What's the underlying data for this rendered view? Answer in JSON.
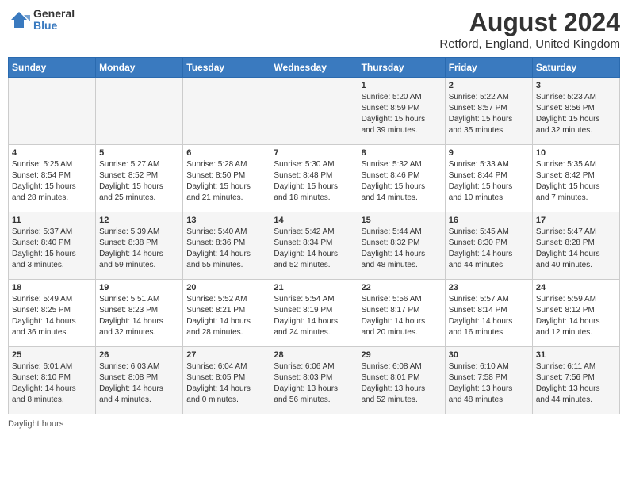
{
  "header": {
    "logo": {
      "general": "General",
      "blue": "Blue"
    },
    "title": "August 2024",
    "location": "Retford, England, United Kingdom"
  },
  "days_of_week": [
    "Sunday",
    "Monday",
    "Tuesday",
    "Wednesday",
    "Thursday",
    "Friday",
    "Saturday"
  ],
  "weeks": [
    [
      {
        "day": "",
        "info": ""
      },
      {
        "day": "",
        "info": ""
      },
      {
        "day": "",
        "info": ""
      },
      {
        "day": "",
        "info": ""
      },
      {
        "day": "1",
        "info": "Sunrise: 5:20 AM\nSunset: 8:59 PM\nDaylight: 15 hours\nand 39 minutes."
      },
      {
        "day": "2",
        "info": "Sunrise: 5:22 AM\nSunset: 8:57 PM\nDaylight: 15 hours\nand 35 minutes."
      },
      {
        "day": "3",
        "info": "Sunrise: 5:23 AM\nSunset: 8:56 PM\nDaylight: 15 hours\nand 32 minutes."
      }
    ],
    [
      {
        "day": "4",
        "info": "Sunrise: 5:25 AM\nSunset: 8:54 PM\nDaylight: 15 hours\nand 28 minutes."
      },
      {
        "day": "5",
        "info": "Sunrise: 5:27 AM\nSunset: 8:52 PM\nDaylight: 15 hours\nand 25 minutes."
      },
      {
        "day": "6",
        "info": "Sunrise: 5:28 AM\nSunset: 8:50 PM\nDaylight: 15 hours\nand 21 minutes."
      },
      {
        "day": "7",
        "info": "Sunrise: 5:30 AM\nSunset: 8:48 PM\nDaylight: 15 hours\nand 18 minutes."
      },
      {
        "day": "8",
        "info": "Sunrise: 5:32 AM\nSunset: 8:46 PM\nDaylight: 15 hours\nand 14 minutes."
      },
      {
        "day": "9",
        "info": "Sunrise: 5:33 AM\nSunset: 8:44 PM\nDaylight: 15 hours\nand 10 minutes."
      },
      {
        "day": "10",
        "info": "Sunrise: 5:35 AM\nSunset: 8:42 PM\nDaylight: 15 hours\nand 7 minutes."
      }
    ],
    [
      {
        "day": "11",
        "info": "Sunrise: 5:37 AM\nSunset: 8:40 PM\nDaylight: 15 hours\nand 3 minutes."
      },
      {
        "day": "12",
        "info": "Sunrise: 5:39 AM\nSunset: 8:38 PM\nDaylight: 14 hours\nand 59 minutes."
      },
      {
        "day": "13",
        "info": "Sunrise: 5:40 AM\nSunset: 8:36 PM\nDaylight: 14 hours\nand 55 minutes."
      },
      {
        "day": "14",
        "info": "Sunrise: 5:42 AM\nSunset: 8:34 PM\nDaylight: 14 hours\nand 52 minutes."
      },
      {
        "day": "15",
        "info": "Sunrise: 5:44 AM\nSunset: 8:32 PM\nDaylight: 14 hours\nand 48 minutes."
      },
      {
        "day": "16",
        "info": "Sunrise: 5:45 AM\nSunset: 8:30 PM\nDaylight: 14 hours\nand 44 minutes."
      },
      {
        "day": "17",
        "info": "Sunrise: 5:47 AM\nSunset: 8:28 PM\nDaylight: 14 hours\nand 40 minutes."
      }
    ],
    [
      {
        "day": "18",
        "info": "Sunrise: 5:49 AM\nSunset: 8:25 PM\nDaylight: 14 hours\nand 36 minutes."
      },
      {
        "day": "19",
        "info": "Sunrise: 5:51 AM\nSunset: 8:23 PM\nDaylight: 14 hours\nand 32 minutes."
      },
      {
        "day": "20",
        "info": "Sunrise: 5:52 AM\nSunset: 8:21 PM\nDaylight: 14 hours\nand 28 minutes."
      },
      {
        "day": "21",
        "info": "Sunrise: 5:54 AM\nSunset: 8:19 PM\nDaylight: 14 hours\nand 24 minutes."
      },
      {
        "day": "22",
        "info": "Sunrise: 5:56 AM\nSunset: 8:17 PM\nDaylight: 14 hours\nand 20 minutes."
      },
      {
        "day": "23",
        "info": "Sunrise: 5:57 AM\nSunset: 8:14 PM\nDaylight: 14 hours\nand 16 minutes."
      },
      {
        "day": "24",
        "info": "Sunrise: 5:59 AM\nSunset: 8:12 PM\nDaylight: 14 hours\nand 12 minutes."
      }
    ],
    [
      {
        "day": "25",
        "info": "Sunrise: 6:01 AM\nSunset: 8:10 PM\nDaylight: 14 hours\nand 8 minutes."
      },
      {
        "day": "26",
        "info": "Sunrise: 6:03 AM\nSunset: 8:08 PM\nDaylight: 14 hours\nand 4 minutes."
      },
      {
        "day": "27",
        "info": "Sunrise: 6:04 AM\nSunset: 8:05 PM\nDaylight: 14 hours\nand 0 minutes."
      },
      {
        "day": "28",
        "info": "Sunrise: 6:06 AM\nSunset: 8:03 PM\nDaylight: 13 hours\nand 56 minutes."
      },
      {
        "day": "29",
        "info": "Sunrise: 6:08 AM\nSunset: 8:01 PM\nDaylight: 13 hours\nand 52 minutes."
      },
      {
        "day": "30",
        "info": "Sunrise: 6:10 AM\nSunset: 7:58 PM\nDaylight: 13 hours\nand 48 minutes."
      },
      {
        "day": "31",
        "info": "Sunrise: 6:11 AM\nSunset: 7:56 PM\nDaylight: 13 hours\nand 44 minutes."
      }
    ]
  ],
  "footer": "Daylight hours"
}
